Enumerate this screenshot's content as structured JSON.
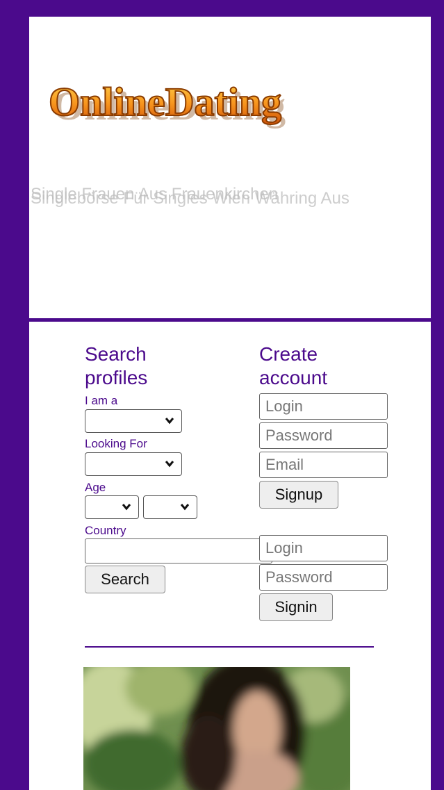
{
  "header": {
    "logo_text": "OnlineDating",
    "ghost_line_1": "Single Frauen Aus Frauenkirchen",
    "ghost_line_2": "Singlebörse Für Singles Wien Währing Aus"
  },
  "search": {
    "title": "Search profiles",
    "i_am_label": "I am a",
    "looking_for_label": "Looking For",
    "age_label": "Age",
    "country_label": "Country",
    "search_button": "Search"
  },
  "create_account": {
    "title": "Create account",
    "login_placeholder": "Login",
    "password_placeholder": "Password",
    "email_placeholder": "Email",
    "signup_button": "Signup"
  },
  "signin": {
    "login_placeholder": "Login",
    "password_placeholder": "Password",
    "signin_button": "Signin"
  },
  "colors": {
    "brand_purple": "#4b0a8c",
    "logo_orange": "#f28a1e"
  }
}
